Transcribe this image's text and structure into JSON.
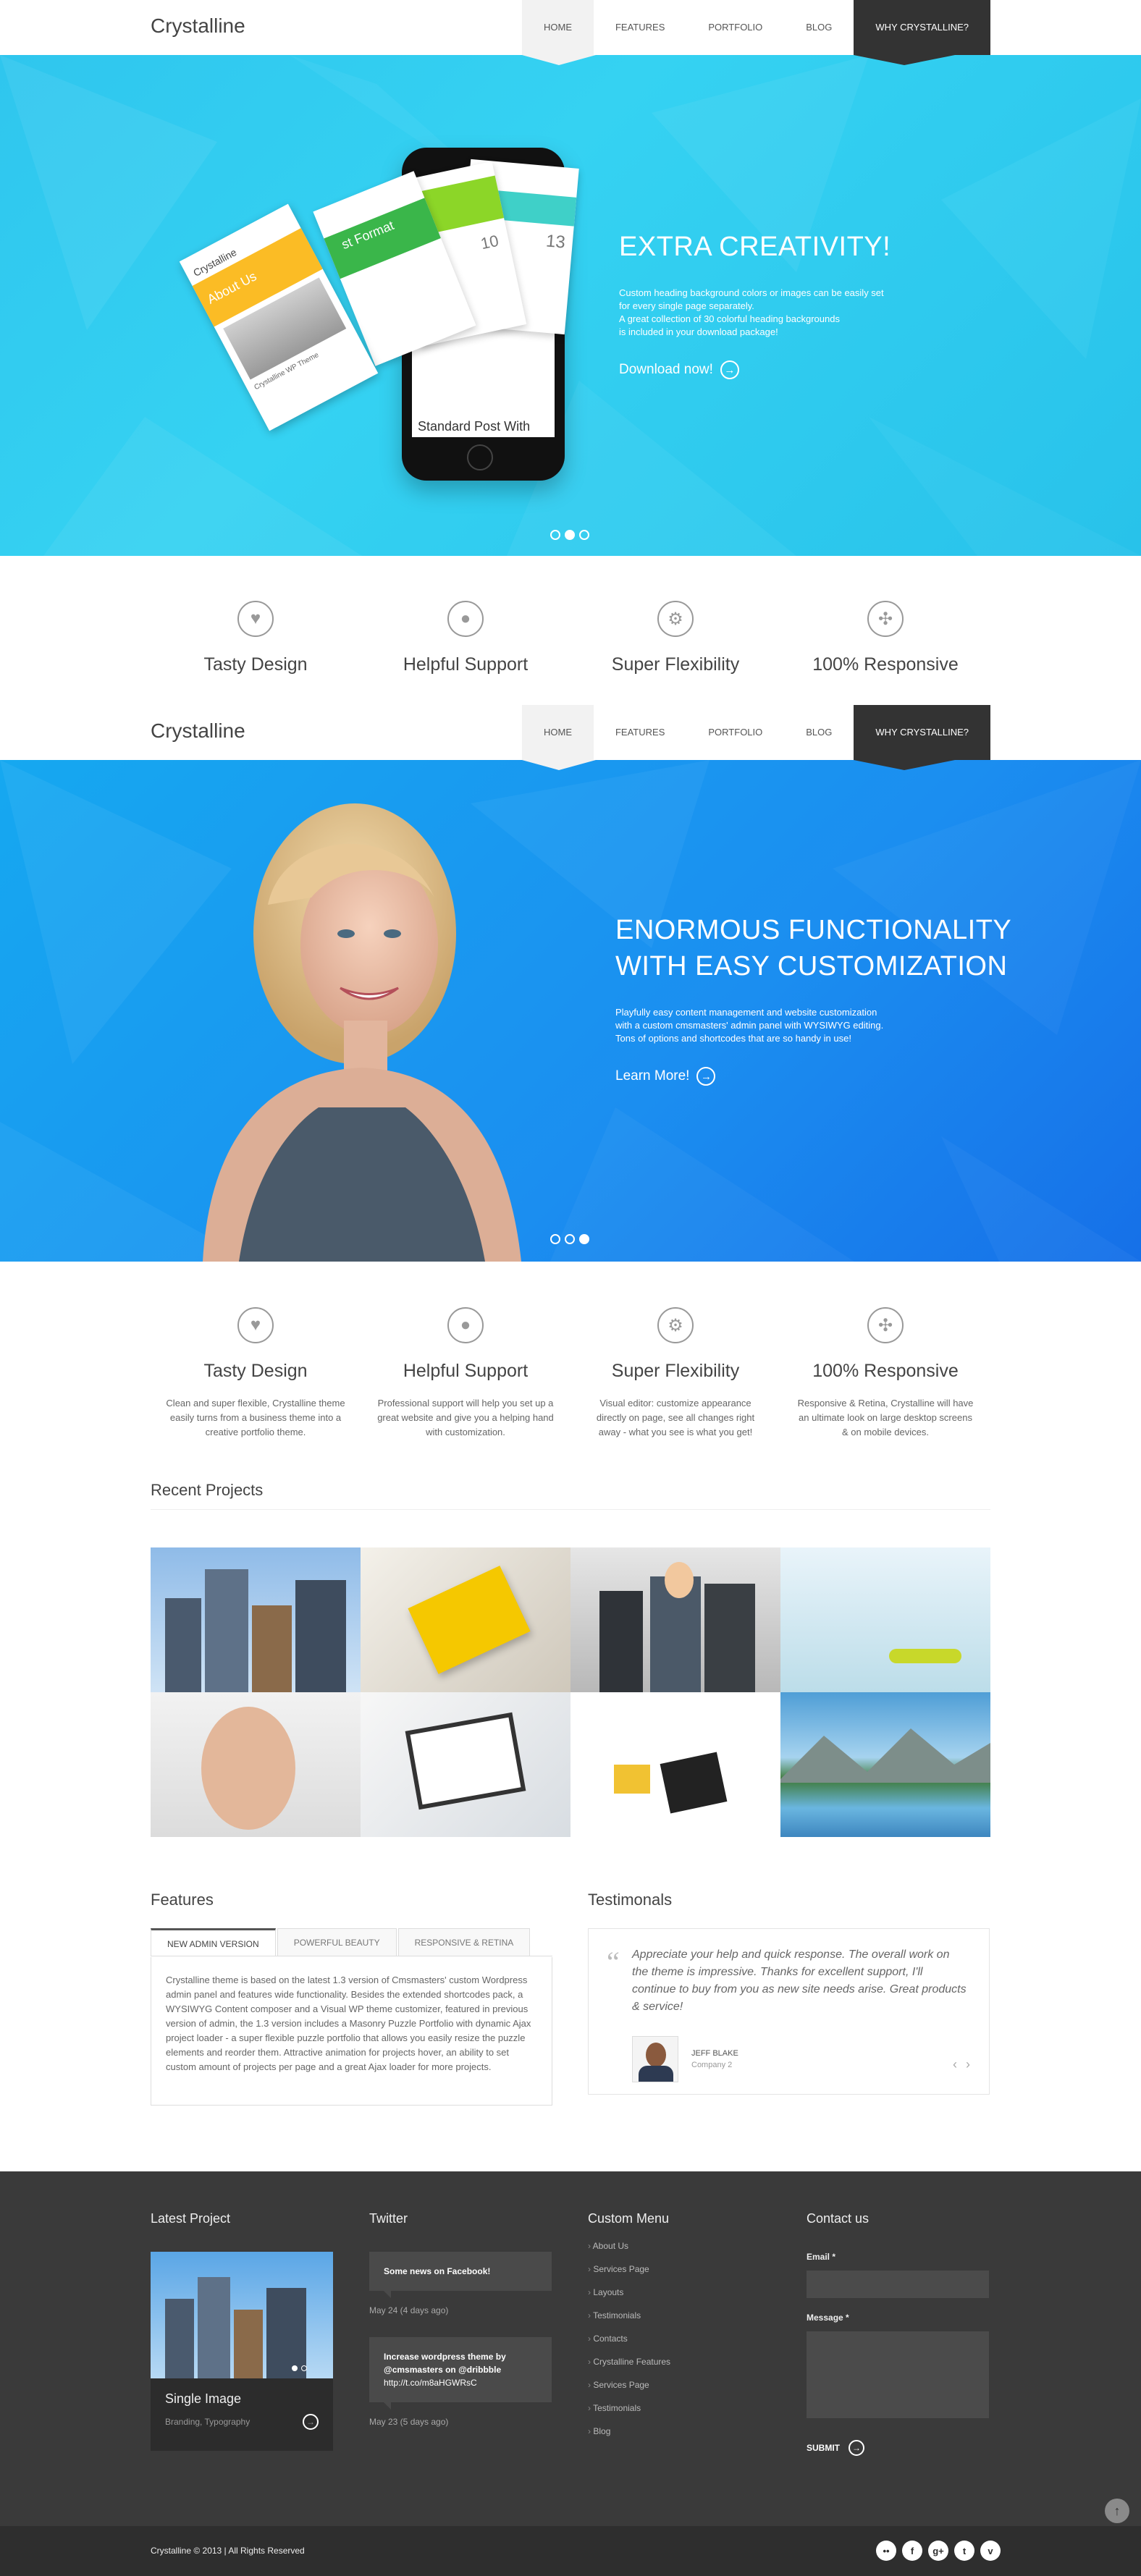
{
  "header": {
    "logo": "Crystalline",
    "nav": [
      "HOME",
      "FEATURES",
      "PORTFOLIO",
      "BLOG",
      "WHY CRYSTALLINE?"
    ]
  },
  "slide1": {
    "title": "EXTRA CREATIVITY!",
    "desc_line1": "Custom heading background colors or images can be easily set",
    "desc_line2": "for every single page separately.",
    "desc_line3": "A great collection of 30 colorful heading backgrounds",
    "desc_line4": "is included in your download package!",
    "link": "Download now!",
    "phone_post": "Standard Post With",
    "card_about": "About Us",
    "card_format": "st Format",
    "card_num1": "10",
    "card_num2": "13",
    "card_brand": "Crystalline",
    "card_theme": "Crystalline WP Theme"
  },
  "slide2": {
    "title_line1": "ENORMOUS FUNCTIONALITY",
    "title_line2": "WITH EASY CUSTOMIZATION",
    "desc_line1": "Playfully easy content management and website customization",
    "desc_line2": "with a custom cmsmasters' admin panel with WYSIWYG editing.",
    "desc_line3": "Tons of options and shortcodes that are so handy in use!",
    "link": "Learn More!"
  },
  "features": [
    {
      "icon": "heart-icon",
      "title": "Tasty Design",
      "text": "Clean and super flexible, Crystalline theme easily turns from a business theme into a creative portfolio theme."
    },
    {
      "icon": "user-icon",
      "title": "Helpful Support",
      "text": "Professional support will help you set up a great website and give you a helping hand with customization."
    },
    {
      "icon": "gears-icon",
      "title": "Super Flexibility",
      "text": "Visual editor: customize appearance directly on page, see all changes right away - what you see is what you get!"
    },
    {
      "icon": "expand-icon",
      "title": "100% Responsive",
      "text": "Responsive & Retina,  Crystalline will have an ultimate look on large desktop screens & on mobile devices."
    }
  ],
  "projects": {
    "title": "Recent Projects"
  },
  "features_tabs": {
    "title": "Features",
    "tabs": [
      "NEW ADMIN VERSION",
      "POWERFUL BEAUTY",
      "RESPONSIVE & RETINA"
    ],
    "body": "Crystalline theme is based on the latest 1.3 version of Cmsmasters' custom Wordpress admin panel and features wide functionality. Besides the extended shortcodes pack, a WYSIWYG Content composer and a Visual WP theme customizer, featured in previous version of admin, the 1.3 version includes a Masonry Puzzle Portfolio with dynamic Ajax project loader - a super flexible puzzle portfolio that allows you easily resize the puzzle elements and reorder them.  Attractive animation for projects hover, an ability to set custom amount of projects per page and a great Ajax loader for more projects."
  },
  "testimonials": {
    "title": "Testimonals",
    "quote": "Appreciate your help and quick response. The overall work on the theme is impressive. Thanks for excellent support, I'll continue to buy from you as new site needs arise. Great products & service!",
    "name": "JEFF BLAKE",
    "company": "Company 2"
  },
  "footer": {
    "latest_title": "Latest Project",
    "project_title": "Single Image",
    "project_tags": "Branding, Typography",
    "twitter_title": "Twitter",
    "tweet1": "Some news on Facebook!",
    "tweet1_date": "May 24 (4 days ago)",
    "tweet2_line1": "Increase wordpress theme by",
    "tweet2_line2": "@cmsmasters on @dribbble",
    "tweet2_line3": "http://t.co/m8aHGWRsC",
    "tweet2_date": "May 23 (5 days ago)",
    "menu_title": "Custom Menu",
    "menu": [
      "About Us",
      "Services Page",
      "Layouts",
      "Testimonials",
      "Contacts",
      "Crystalline Features",
      "Services Page",
      "Testimonials",
      "Blog"
    ],
    "contact_title": "Contact us",
    "email_label": "Email *",
    "message_label": "Message *",
    "submit": "SUBMIT",
    "copyright": "Crystalline © 2013 | All Rights Reserved",
    "social": [
      "flickr-icon",
      "facebook-icon",
      "googleplus-icon",
      "twitter-icon",
      "vimeo-icon"
    ]
  },
  "colors": {
    "slide1": "#2fc6ee",
    "slide2": "#1b8ef0",
    "footer": "#3a3a3a",
    "nav_dark": "#333333"
  }
}
